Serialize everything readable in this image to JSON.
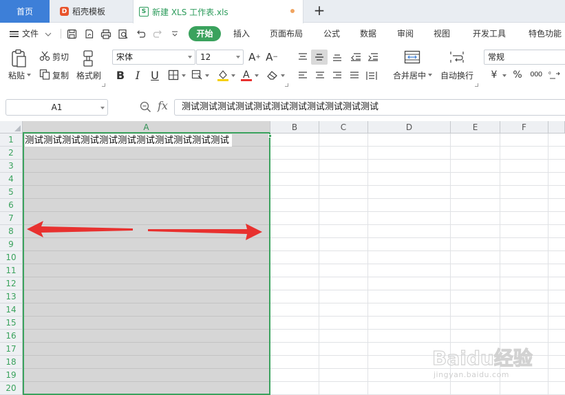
{
  "tabs": {
    "home": "首页",
    "daoke": "稻壳模板",
    "file": "新建 XLS 工作表.xls",
    "add": "+"
  },
  "menu": {
    "file": "文件",
    "start": "开始",
    "insert": "插入",
    "page_layout": "页面布局",
    "formula": "公式",
    "data": "数据",
    "review": "审阅",
    "view": "视图",
    "developer": "开发工具",
    "special": "特色功能"
  },
  "ribbon": {
    "paste": "粘贴",
    "cut": "剪切",
    "copy": "复制",
    "format_painter": "格式刷",
    "font_name": "宋体",
    "font_size": "12",
    "merge_center": "合并居中",
    "wrap_text": "自动换行",
    "number_format": "常规",
    "currency": "¥",
    "percent": "%",
    "thousands": "000"
  },
  "formula_bar": {
    "name_box": "A1",
    "fx": "fx",
    "content": "测试测试测试测试测试测试测试测试测试测试测试"
  },
  "grid": {
    "columns": [
      "A",
      "B",
      "C",
      "D",
      "E",
      "F"
    ],
    "rows": [
      "1",
      "2",
      "3",
      "4",
      "5",
      "6",
      "7",
      "8",
      "9",
      "10",
      "11",
      "12",
      "13",
      "14",
      "15",
      "16",
      "17",
      "18",
      "19",
      "20"
    ],
    "cell_a1": "测试测试测试测试测试测试测试测试测试测试测试",
    "selected_column": "A"
  },
  "watermark": {
    "logo": "Baidu经验",
    "url": "jingyan.baidu.com"
  },
  "colors": {
    "accent_green": "#3aa25d",
    "home_tab_blue": "#3d7fd8",
    "arrow_red": "#e8312f"
  }
}
